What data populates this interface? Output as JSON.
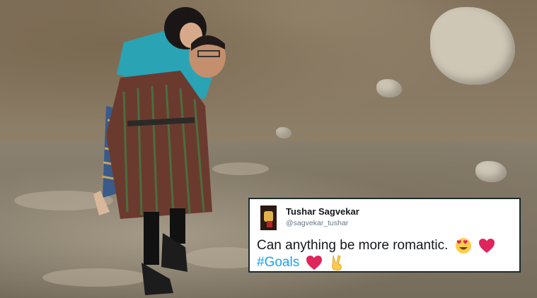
{
  "tweet": {
    "author_name": "Tushar Sagvekar",
    "author_handle": "@sagvekar_tushar",
    "text_line1": "Can anything be more romantic.",
    "hashtag": "#Goals",
    "icons": [
      "heart-eyes-emoji",
      "red-heart-emoji",
      "red-heart-emoji",
      "victory-hand-emoji"
    ]
  },
  "colors": {
    "hashtag": "#1da1f2",
    "card_border": "#1d2b2b",
    "heart": "#e0245e",
    "emoji_face": "#ffcc4d"
  }
}
